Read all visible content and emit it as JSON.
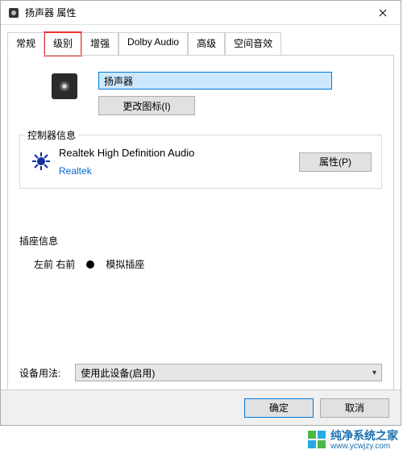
{
  "titlebar": {
    "title": "扬声器 属性"
  },
  "tabs": [
    {
      "label": "常规"
    },
    {
      "label": "级别"
    },
    {
      "label": "增强"
    },
    {
      "label": "Dolby Audio"
    },
    {
      "label": "高级"
    },
    {
      "label": "空间音效"
    }
  ],
  "general": {
    "device_name": "扬声器",
    "change_icon_btn": "更改图标(I)"
  },
  "controller": {
    "group_label": "控制器信息",
    "name": "Realtek High Definition Audio",
    "vendor": "Realtek",
    "properties_btn": "属性(P)"
  },
  "jack": {
    "group_label": "插座信息",
    "position": "左前 右前",
    "type": "模拟插座"
  },
  "usage": {
    "label": "设备用法:",
    "selected": "使用此设备(启用)"
  },
  "footer": {
    "ok": "确定",
    "cancel": "取消"
  },
  "watermark": {
    "text": "纯净系统之家",
    "url": "www.ycwjzy.com"
  }
}
